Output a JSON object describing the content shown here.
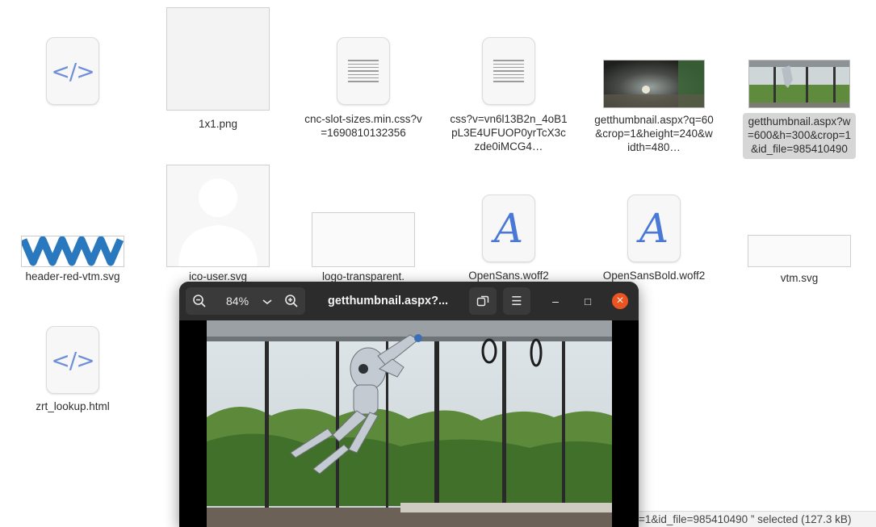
{
  "files": [
    {
      "label": "",
      "icon": "code-file-icon"
    },
    {
      "label": "1x1.png",
      "icon": "blank-image-icon"
    },
    {
      "label": "cnc-slot-sizes.min.css?v=1690810132356",
      "icon": "text-file-icon"
    },
    {
      "label": "css?v=vn6l13B2n_4oB1pL3E4UFUOP0yrTcX3czde0iMCG4…",
      "icon": "text-file-icon"
    },
    {
      "label": "getthumbnail.aspx?q=60&crop=1&height=240&width=480…",
      "icon": "photo-thumbnail-icon"
    },
    {
      "label": "getthumbnail.aspx?w=600&h=300&crop=1&id_file=985410490",
      "icon": "photo-thumbnail-icon",
      "selected": true
    },
    {
      "label": "header-red-vtm.svg",
      "icon": "wave-logo-icon"
    },
    {
      "label": "ico-user.svg",
      "icon": "user-silhouette-icon"
    },
    {
      "label": "logo-transparent.",
      "icon": "logo-image-icon"
    },
    {
      "label": "OpenSans.woff2",
      "icon": "font-file-icon"
    },
    {
      "label": "OpenSansBold.woff2",
      "icon": "font-file-icon"
    },
    {
      "label": "vtm.svg",
      "icon": "logo-image-icon"
    },
    {
      "label": "zrt_lookup.html",
      "icon": "code-file-icon"
    }
  ],
  "glyphs": {
    "code": "</>",
    "font": "A"
  },
  "viewer": {
    "zoom": "84%",
    "title": "getthumbnail.aspx?...",
    "zoom_out": "−",
    "zoom_in": "+",
    "menu": "☰",
    "minimize": "–",
    "maximize": "□",
    "close": "×"
  },
  "status": {
    "text": "=1&id_file=985410490 ” selected  (127.3 kB)"
  }
}
